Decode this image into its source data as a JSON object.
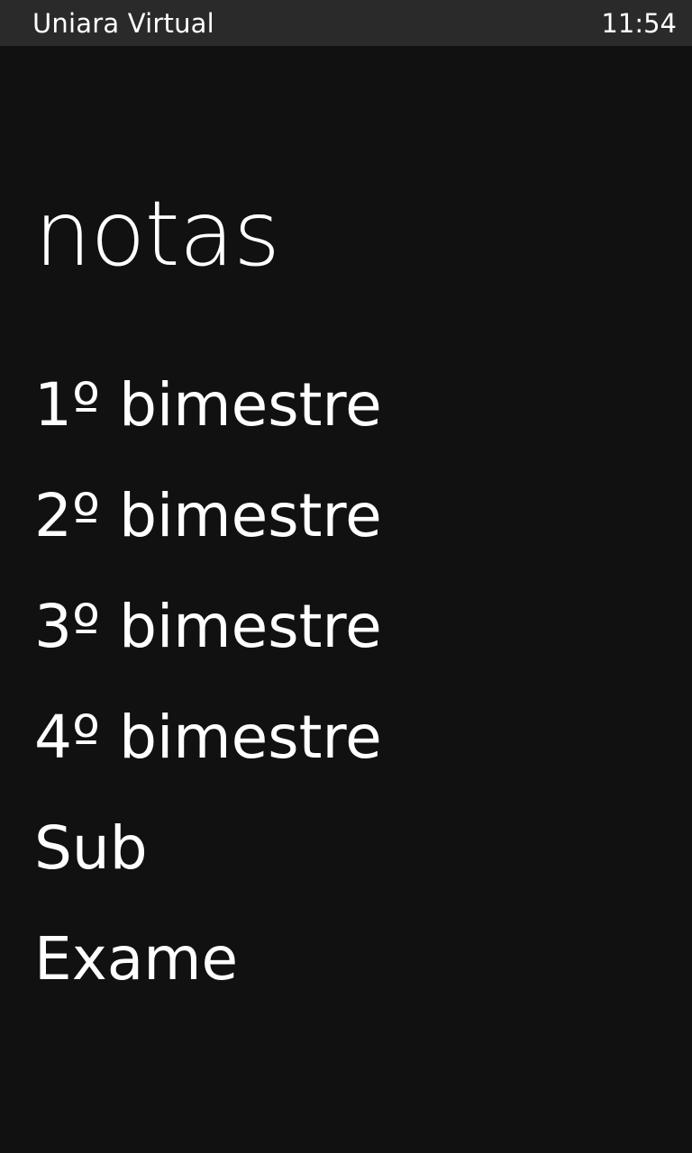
{
  "status_bar": {
    "app_name": "Uniara Virtual",
    "time": "11:54"
  },
  "page": {
    "title": "notas"
  },
  "menu": {
    "items": [
      {
        "label": "1º bimestre"
      },
      {
        "label": "2º bimestre"
      },
      {
        "label": "3º bimestre"
      },
      {
        "label": "4º bimestre"
      },
      {
        "label": "Sub"
      },
      {
        "label": "Exame"
      }
    ]
  }
}
